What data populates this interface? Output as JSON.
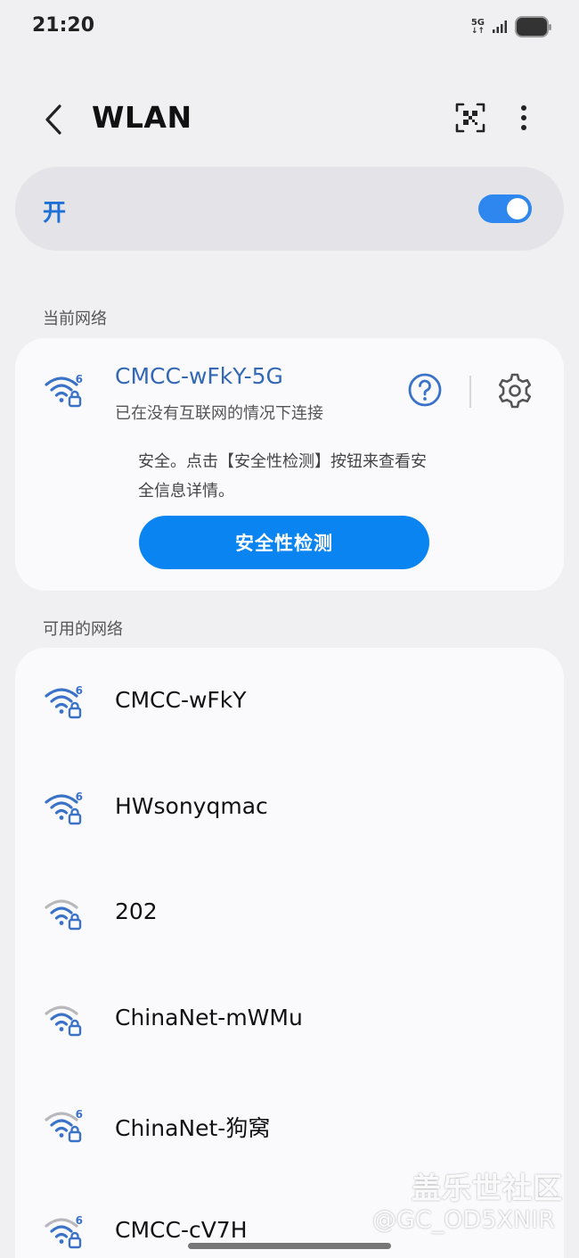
{
  "status_bar": {
    "time": "21:20",
    "network_type": "5G",
    "network_arrows": "↓↑",
    "icons": [
      "signal-icon",
      "battery-icon"
    ]
  },
  "header": {
    "title": "WLAN",
    "icons": [
      "back-arrow-icon",
      "qr-scan-icon",
      "more-vertical-icon"
    ]
  },
  "toggle": {
    "label": "开",
    "enabled": true
  },
  "current_section": {
    "label": "当前网络",
    "network": {
      "name": "CMCC-wFkY-5G",
      "status": "已在没有互联网的情况下连接",
      "wifi_standard": "6",
      "signal_level": "full",
      "secured": true
    },
    "security_info": "安全。点击【安全性检测】按钮来查看安全信息详情。",
    "button_label": "安全性检测",
    "icons": [
      "help-icon",
      "gear-icon"
    ]
  },
  "available_section": {
    "label": "可用的网络",
    "networks": [
      {
        "name": "CMCC-wFkY",
        "wifi_standard": "6",
        "signal_level": "full",
        "secured": true
      },
      {
        "name": "HWsonyqmac",
        "wifi_standard": "6",
        "signal_level": "full",
        "secured": true
      },
      {
        "name": "202",
        "wifi_standard": "",
        "signal_level": "medium",
        "secured": true
      },
      {
        "name": "ChinaNet-mWMu",
        "wifi_standard": "",
        "signal_level": "medium",
        "secured": true
      },
      {
        "name": "ChinaNet-狗窝",
        "wifi_standard": "6",
        "signal_level": "medium",
        "secured": true
      },
      {
        "name": "CMCC-cV7H",
        "wifi_standard": "6",
        "signal_level": "medium",
        "secured": true
      }
    ]
  },
  "watermark": {
    "line1": "盖乐世社区",
    "line2": "@GC_OD5XNIR"
  },
  "colors": {
    "accent": "#2e86ef",
    "button": "#0a84f0",
    "wifi_active": "#3a72c8",
    "wifi_inactive": "#b7b7bc",
    "background": "#f0f0f3",
    "card": "#fafafd"
  }
}
